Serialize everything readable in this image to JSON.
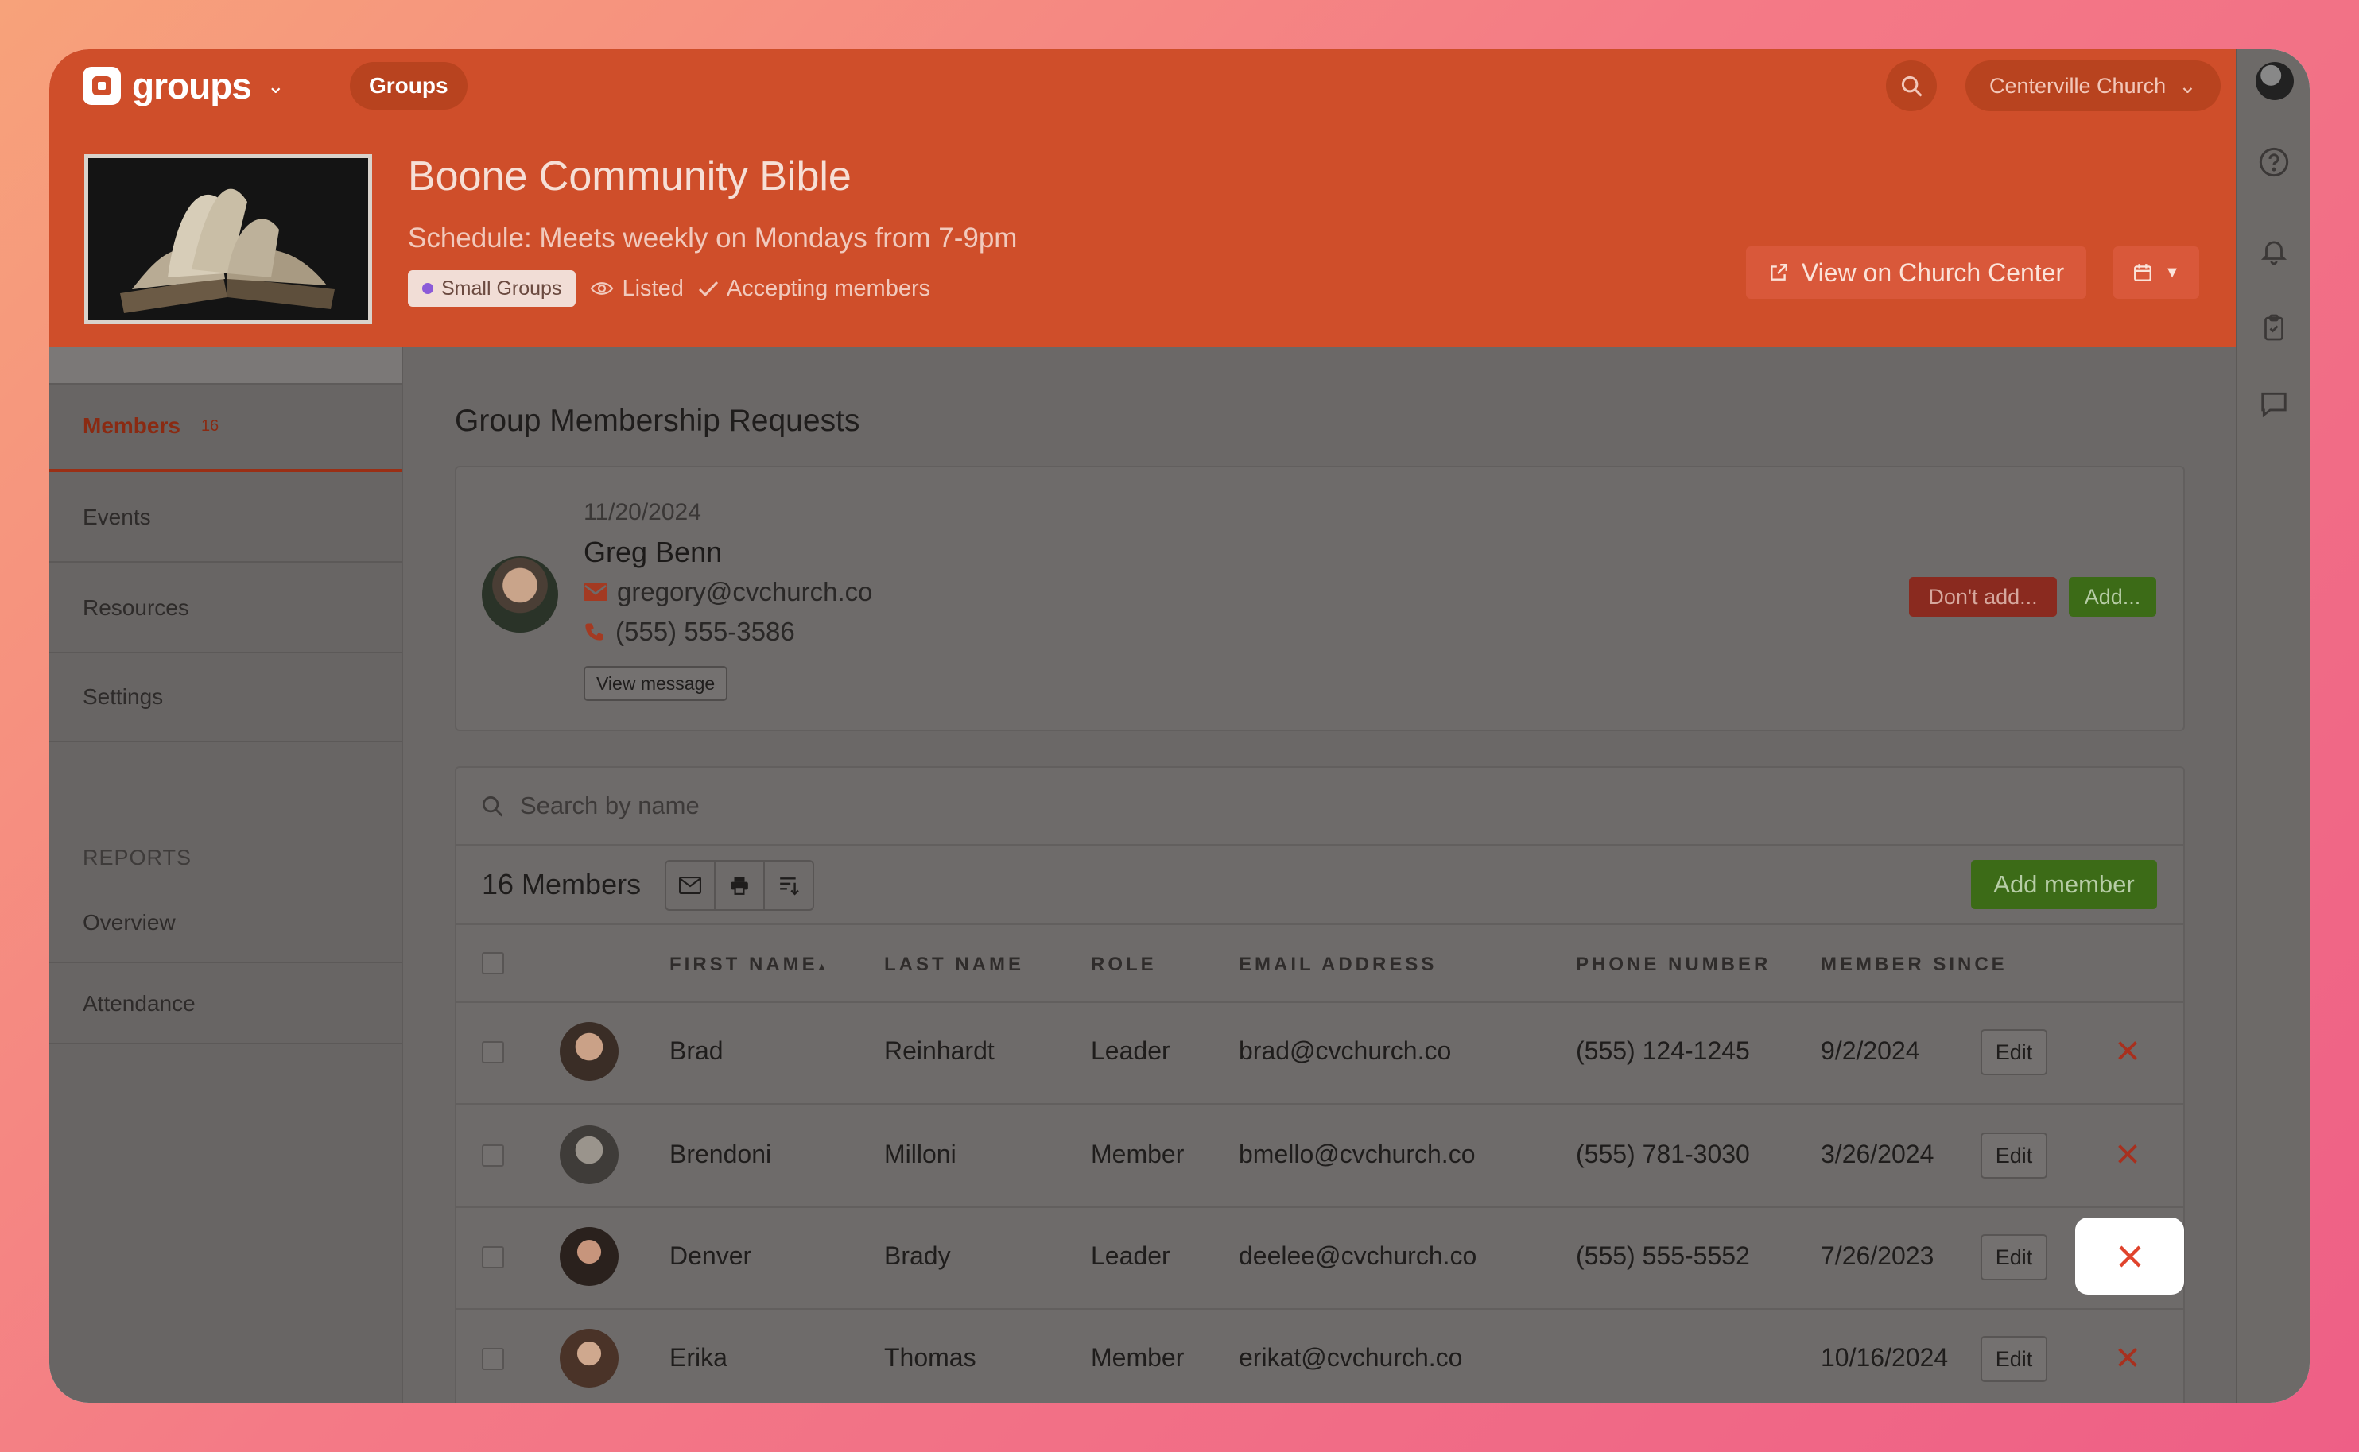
{
  "app": {
    "name": "groups",
    "nav_tab": "Groups",
    "church": "Centerville Church"
  },
  "group": {
    "title": "Boone Community Bible",
    "schedule": "Schedule: Meets weekly on Mondays from 7-9pm",
    "type_chip": "Small Groups",
    "visibility": "Listed",
    "enrollment": "Accepting members",
    "view_button": "View on Church Center"
  },
  "sidebar": {
    "items": [
      {
        "label": "Members",
        "count": "16"
      },
      {
        "label": "Events"
      },
      {
        "label": "Resources"
      },
      {
        "label": "Settings"
      }
    ],
    "reports_heading": "REPORTS",
    "reports": [
      {
        "label": "Overview"
      },
      {
        "label": "Attendance"
      }
    ]
  },
  "requests": {
    "title": "Group Membership Requests",
    "date": "11/20/2024",
    "name": "Greg Benn",
    "email": "gregory@cvchurch.co",
    "phone": "(555) 555-3586",
    "view_message": "View message",
    "dont_add": "Don't add...",
    "add": "Add..."
  },
  "members": {
    "search_placeholder": "Search by name",
    "count_label": "16 Members",
    "add_member": "Add member",
    "columns": [
      "FIRST NAME",
      "LAST NAME",
      "ROLE",
      "EMAIL ADDRESS",
      "PHONE NUMBER",
      "MEMBER SINCE"
    ],
    "sort_indicator": "▲",
    "edit_label": "Edit",
    "rows": [
      {
        "first": "Brad",
        "last": "Reinhardt",
        "role": "Leader",
        "email": "brad@cvchurch.co",
        "phone": "(555) 124-1245",
        "since": "9/2/2024"
      },
      {
        "first": "Brendoni",
        "last": "Milloni",
        "role": "Member",
        "email": "bmello@cvchurch.co",
        "phone": "(555) 781-3030",
        "since": "3/26/2024"
      },
      {
        "first": "Denver",
        "last": "Brady",
        "role": "Leader",
        "email": "deelee@cvchurch.co",
        "phone": "(555) 555-5552",
        "since": "7/26/2023"
      },
      {
        "first": "Erika",
        "last": "Thomas",
        "role": "Member",
        "email": "erikat@cvchurch.co",
        "phone": "",
        "since": "10/16/2024"
      }
    ]
  },
  "colors": {
    "brand": "#cf4e2a",
    "success": "#3c6b17",
    "danger": "#c8301c"
  }
}
